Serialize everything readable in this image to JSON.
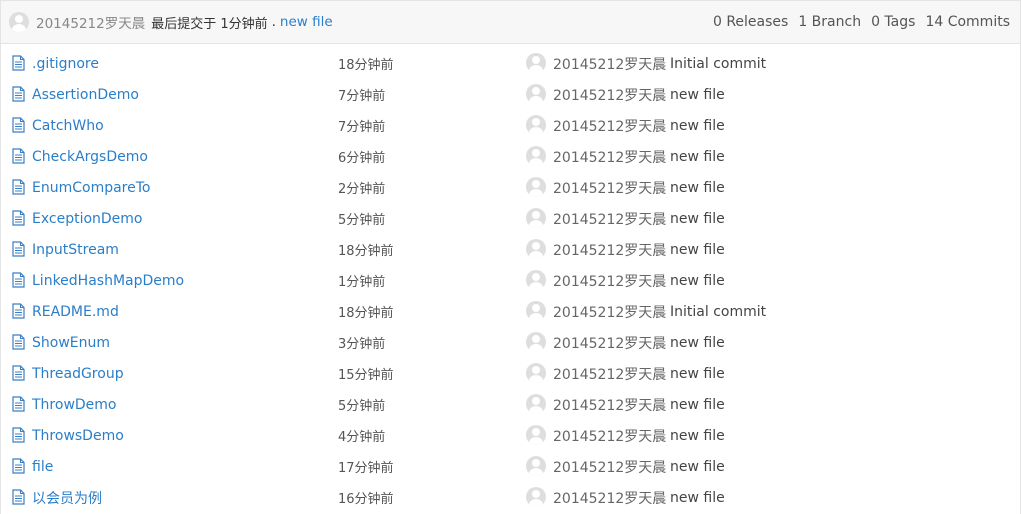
{
  "header": {
    "author": "20145212罗天晨",
    "prefix": "最后提交于 1分钟前",
    "separator": ".",
    "last_message": "new file",
    "releases": "0 Releases",
    "branch": "1 Branch",
    "tags": "0 Tags",
    "commits": "14 Commits"
  },
  "colors": {
    "link": "#2a7ec8",
    "header_bg": "#f7f7f7",
    "border": "#e4e4e4"
  },
  "icons": {
    "file": "file-icon",
    "avatar": "user-avatar-icon"
  },
  "files": [
    {
      "name": ".gitignore",
      "age": "18分钟前",
      "author": "20145212罗天晨",
      "message": "Initial commit"
    },
    {
      "name": "AssertionDemo",
      "age": "7分钟前",
      "author": "20145212罗天晨",
      "message": "new file"
    },
    {
      "name": "CatchWho",
      "age": "7分钟前",
      "author": "20145212罗天晨",
      "message": "new file"
    },
    {
      "name": "CheckArgsDemo",
      "age": "6分钟前",
      "author": "20145212罗天晨",
      "message": "new file"
    },
    {
      "name": "EnumCompareTo",
      "age": "2分钟前",
      "author": "20145212罗天晨",
      "message": "new file"
    },
    {
      "name": "ExceptionDemo",
      "age": "5分钟前",
      "author": "20145212罗天晨",
      "message": "new file"
    },
    {
      "name": "InputStream",
      "age": "18分钟前",
      "author": "20145212罗天晨",
      "message": "new file"
    },
    {
      "name": "LinkedHashMapDemo",
      "age": "1分钟前",
      "author": "20145212罗天晨",
      "message": "new file"
    },
    {
      "name": "README.md",
      "age": "18分钟前",
      "author": "20145212罗天晨",
      "message": "Initial commit"
    },
    {
      "name": "ShowEnum",
      "age": "3分钟前",
      "author": "20145212罗天晨",
      "message": "new file"
    },
    {
      "name": "ThreadGroup",
      "age": "15分钟前",
      "author": "20145212罗天晨",
      "message": "new file"
    },
    {
      "name": "ThrowDemo",
      "age": "5分钟前",
      "author": "20145212罗天晨",
      "message": "new file"
    },
    {
      "name": "ThrowsDemo",
      "age": "4分钟前",
      "author": "20145212罗天晨",
      "message": "new file"
    },
    {
      "name": "file",
      "age": "17分钟前",
      "author": "20145212罗天晨",
      "message": "new file"
    },
    {
      "name": "以会员为例",
      "age": "16分钟前",
      "author": "20145212罗天晨",
      "message": "new file"
    }
  ]
}
